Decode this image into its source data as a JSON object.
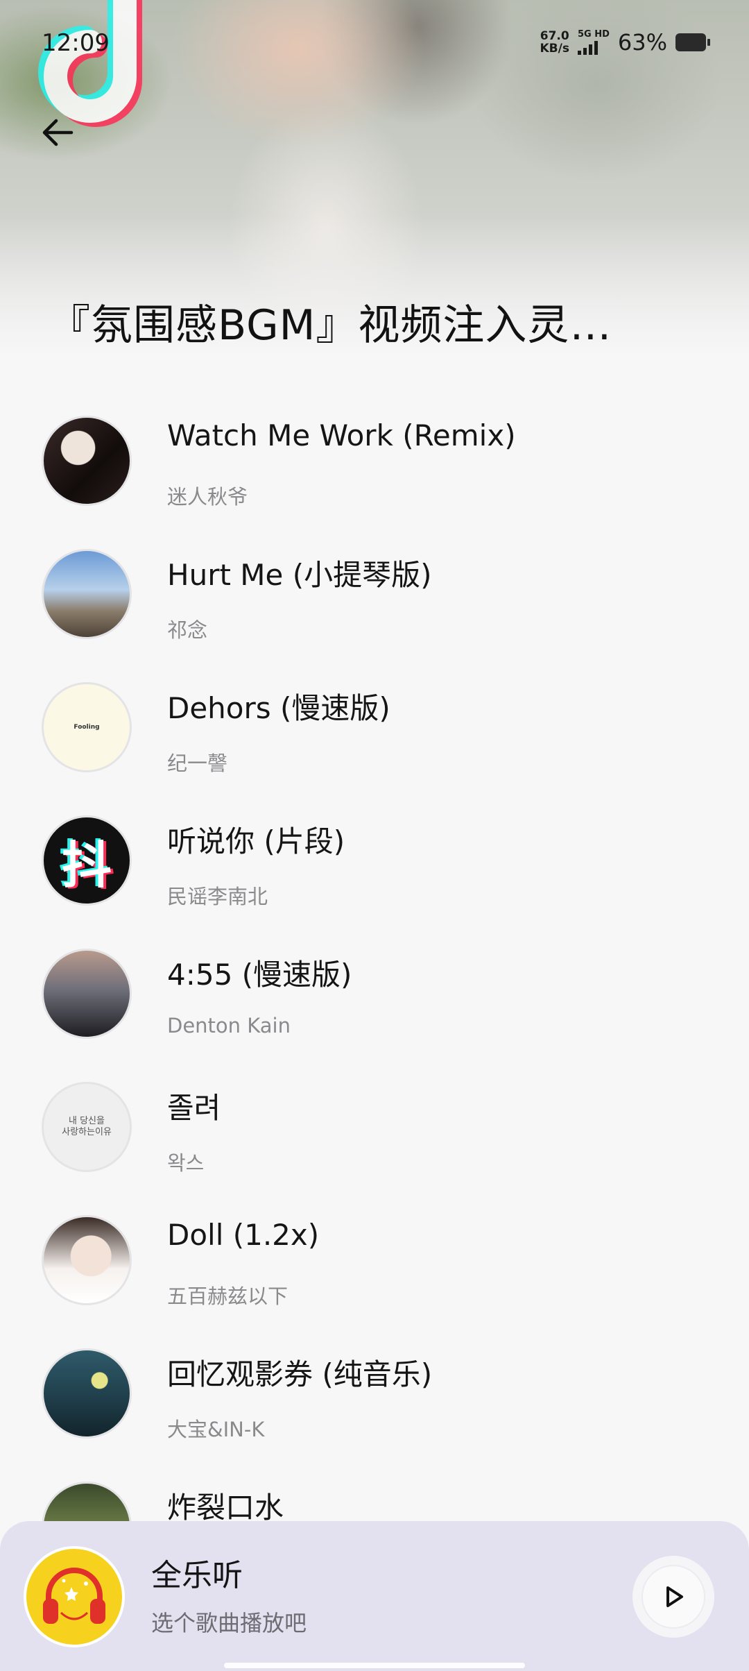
{
  "status_bar": {
    "time": "12:09",
    "net_speed_value": "67.0",
    "net_speed_unit": "KB/s",
    "net_type_top": "5G HD",
    "battery_percent": "63%"
  },
  "header": {
    "back_icon": "arrow-left-icon",
    "logo_icon": "tiktok-logo-icon",
    "title": "『氛围感BGM』视频注入灵…"
  },
  "songs": [
    {
      "title": "Watch Me Work (Remix)",
      "artist": "迷人秋爷",
      "cover": "portrait-dark"
    },
    {
      "title": "Hurt Me (小提琴版)",
      "artist": "祁念",
      "cover": "seaside-photo"
    },
    {
      "title": "Dehors (慢速版)",
      "artist": "纪一謦",
      "cover": "text-cover",
      "cover_text": "Fooling"
    },
    {
      "title": "听说你 (片段)",
      "artist": "民谣李南北",
      "cover": "douyin-logo",
      "cover_text": "抖"
    },
    {
      "title": "4:55 (慢速版)",
      "artist": "Denton Kain",
      "cover": "sunset-silhouette"
    },
    {
      "title": "졸려",
      "artist": "왁스",
      "cover": "korean-text-cover",
      "cover_line1": "내 당신을",
      "cover_line2": "사랑하는이유"
    },
    {
      "title": "Doll (1.2x)",
      "artist": "五百赫兹以下",
      "cover": "portrait-light"
    },
    {
      "title": "回忆观影券 (纯音乐)",
      "artist": "大宝&IN-K",
      "cover": "night-illustration"
    },
    {
      "title": "炸裂口水",
      "artist": "",
      "cover": "forest"
    }
  ],
  "mini_player": {
    "title": "全乐听",
    "subtitle": "选个歌曲播放吧",
    "art_icon": "headphones-icon",
    "play_icon": "play-icon"
  },
  "colors": {
    "background": "#f7f7f8",
    "player_bg": "#e3e1ef",
    "player_art": "#f6d11e",
    "headphones_red": "#e0302a"
  }
}
